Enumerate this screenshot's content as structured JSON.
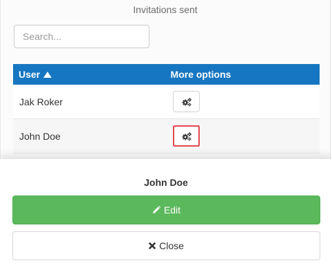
{
  "panel": {
    "title": "Invitations sent",
    "search": {
      "placeholder": "Search...",
      "value": ""
    }
  },
  "table": {
    "columns": {
      "user": "User",
      "options": "More options"
    },
    "sort": {
      "column": "user",
      "direction": "ascending",
      "icon": "sort-asc-icon"
    },
    "rows": [
      {
        "name": "Jak Roker",
        "action_icon": "gears-icon"
      },
      {
        "name": "John Doe",
        "action_icon": "gears-icon",
        "highlighted": true
      }
    ]
  },
  "sheet": {
    "title": "John Doe",
    "edit_label": "Edit",
    "edit_icon": "pencil-icon",
    "close_label": "Close",
    "close_icon": "close-icon"
  },
  "colors": {
    "header_bg": "#1776c1",
    "edit_bg": "#5cb85c",
    "highlight_border": "#e0474c"
  }
}
